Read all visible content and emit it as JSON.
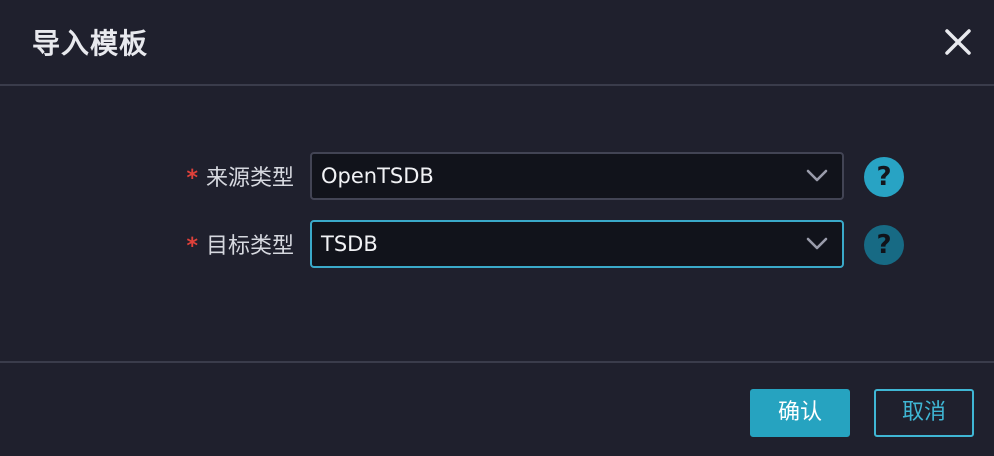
{
  "dialog": {
    "title": "导入模板",
    "close_icon": "close-icon"
  },
  "form": {
    "source_type": {
      "required_mark": "*",
      "label": "来源类型",
      "value": "OpenTSDB",
      "help_text": "?"
    },
    "target_type": {
      "required_mark": "*",
      "label": "目标类型",
      "value": "TSDB",
      "help_text": "?"
    }
  },
  "footer": {
    "confirm_label": "确认",
    "cancel_label": "取消"
  },
  "colors": {
    "background": "#1f202d",
    "accent": "#26a3c0",
    "required": "#e0413a",
    "input_bg": "#11131b"
  }
}
